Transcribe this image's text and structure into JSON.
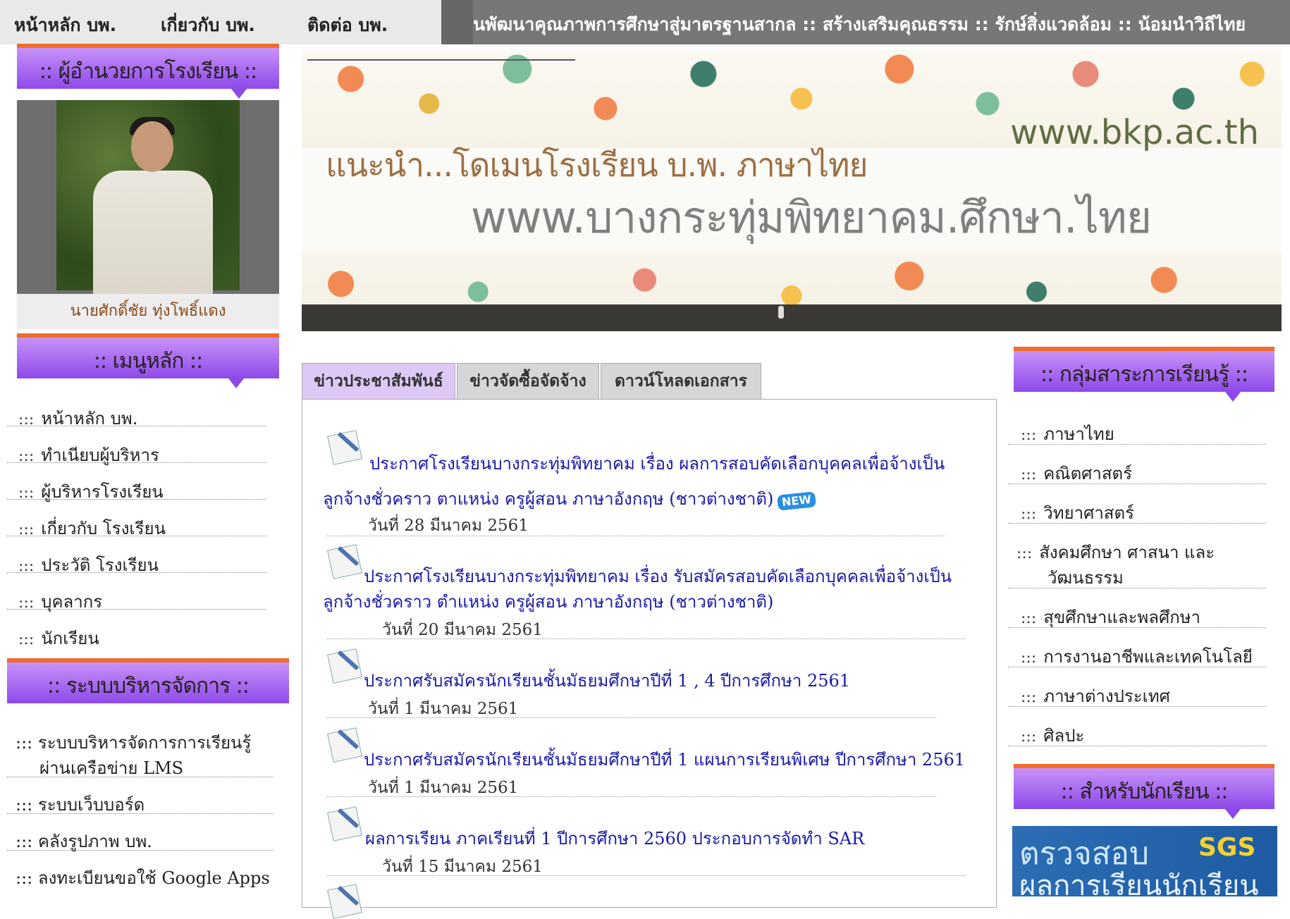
{
  "topnav": {
    "home": "หน้าหลัก บพ.",
    "about": "เกี่ยวกับ บพ.",
    "contact": "ติดต่อ บพ.",
    "marquee": "นพัฒนาคุณภาพการศึกษาสู่มาตรฐานสากล :: สร้างเสริมคุณธรรม :: รักษ์สิ่งแวดล้อม :: น้อมนำวิถีไทย"
  },
  "director": {
    "heading": ":: ผู้อำนวยการโรงเรียน ::",
    "caption": "นายศักดิ์ชัย ทุ่งโพธิ์แดง"
  },
  "main_menu": {
    "heading": ":: เมนูหลัก ::",
    "prefix": ":::",
    "items": [
      "หน้าหลัก บพ.",
      "ทำเนียบผู้บริหาร",
      "ผู้บริหารโรงเรียน",
      "เกี่ยวกับ โรงเรียน",
      "ประวัติ โรงเรียน",
      "บุคลากร",
      "นักเรียน"
    ]
  },
  "admin_menu": {
    "heading": ":: ระบบบริหารจัดการ ::",
    "items": [
      {
        "line1": "::: ระบบบริหารจัดการการเรียนรู้",
        "line2": "ผ่านเครือข่าย LMS"
      },
      {
        "line1": "::: ระบบเว็บบอร์ด"
      },
      {
        "line1": "::: คลังรูปภาพ บพ."
      },
      {
        "line1": "::: ลงทะเบียนขอใช้ Google Apps"
      }
    ]
  },
  "banner": {
    "domain_en": "www.bkp.ac.th",
    "intro": "แนะนำ...โดเมนโรงเรียน บ.พ. ภาษาไทย",
    "domain_th": "www.บางกระทุ่มพิทยาคม.ศึกษา.ไทย"
  },
  "tabs": [
    "ข่าวประชาสัมพันธ์",
    "ข่าวจัดซื้อจัดจ้าง",
    "ดาวน์โหลดเอกสาร"
  ],
  "news": [
    {
      "line1": "ประกาศโรงเรียนบางกระทุ่มพิทยาคม เรื่อง ผลการสอบคัดเลือกบุคคลเพื่อจ้างเป็น",
      "line2": "ลูกจ้างชั่วคราว ตาแหน่ง ครูผู้สอน ภาษาอังกฤษ (ชาวต่างชาติ)",
      "date": "วันที่ 28 มีนาคม 2561",
      "badge": "NEW"
    },
    {
      "line1": "ประกาศโรงเรียนบางกระทุ่มพิทยาคม เรื่อง รับสมัครสอบคัดเลือกบุคคลเพื่อจ้างเป็น",
      "line2": "ลูกจ้างชั่วคราว ตำแหน่ง ครูผู้สอน ภาษาอังกฤษ (ชาวต่างชาติ)",
      "date": "วันที่ 20 มีนาคม 2561"
    },
    {
      "line1": "ประกาศรับสมัครนักเรียนชั้นมัธยมศึกษาปีที่ 1 , 4 ปีการศึกษา 2561",
      "date": "วันที่ 1 มีนาคม 2561"
    },
    {
      "line1": "ประกาศรับสมัครนักเรียนชั้นมัธยมศึกษาปีที่ 1 แผนการเรียนพิเศษ ปีการศึกษา 2561",
      "date": "วันที่ 1 มีนาคม 2561"
    },
    {
      "line1": "ผลการเรียน ภาคเรียนที่ 1 ปีการศึกษา 2560 ประกอบการจัดทำ SAR",
      "date": "วันที่ 15 มีนาคม 2561"
    }
  ],
  "subjects": {
    "heading": ":: กลุ่มสาระการเรียนรู้ ::",
    "prefix": ":::",
    "items": [
      {
        "line1": "ภาษาไทย"
      },
      {
        "line1": "คณิตศาสตร์"
      },
      {
        "line1": "วิทยาศาสตร์"
      },
      {
        "line1": "สังคมศึกษา ศาสนา และ",
        "line2": "วัฒนธรรม"
      },
      {
        "line1": "สุขศึกษาและพลศึกษา"
      },
      {
        "line1": "การงานอาชีพและเทคโนโลยี"
      },
      {
        "line1": "ภาษาต่างประเทศ"
      },
      {
        "line1": "ศิลปะ"
      }
    ]
  },
  "students": {
    "heading": ":: สำหรับนักเรียน ::",
    "banner_line1": "ตรวจสอบ",
    "banner_sgs": "SGS",
    "banner_line2": "ผลการเรียนนักเรียน"
  }
}
